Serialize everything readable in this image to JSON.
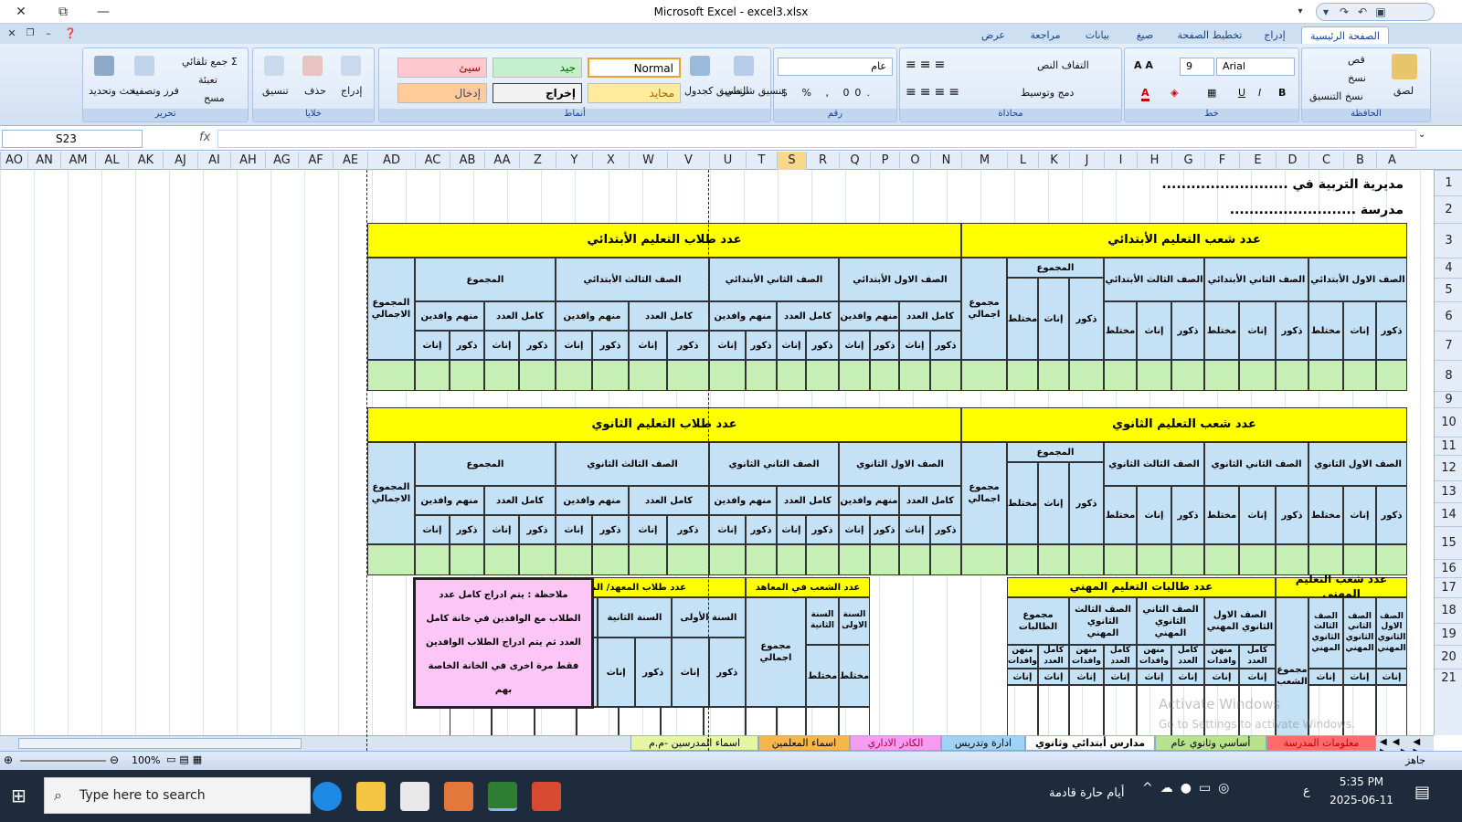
{
  "app": {
    "title": "Microsoft Excel - excel3.xlsx"
  },
  "window": {
    "close": "✕",
    "restore": "⧉",
    "minimize": "—"
  },
  "ribbon_tabs": [
    "الصفحة الرئيسية",
    "إدراج",
    "تخطيط الصفحة",
    "صيغ",
    "بيانات",
    "مراجعة",
    "عرض"
  ],
  "ribbon": {
    "clipboard": {
      "label": "الحافظة",
      "paste": "لصق",
      "cut": "قص",
      "copy": "نسخ",
      "format_painter": "نسخ التنسيق"
    },
    "font": {
      "label": "خط",
      "name": "Arial",
      "size": "9"
    },
    "alignment": {
      "label": "محاذاة",
      "wrap": "التفاف النص",
      "merge": "دمج وتوسيط"
    },
    "number": {
      "label": "رقم",
      "format": "عام"
    },
    "styles": {
      "label": "أنماط",
      "conditional": "تنسيق شرطي",
      "as_table": "التنسيق كجدول",
      "normal": "Normal",
      "good": "جيد",
      "bad": "سيئ",
      "neutral": "محايد",
      "output": "إخراج",
      "input": "إدخال"
    },
    "cells": {
      "label": "خلايا",
      "insert": "إدراج",
      "delete": "حذف",
      "format": "تنسيق"
    },
    "editing": {
      "label": "تحرير",
      "autosum": "جمع تلقائي",
      "fill": "تعبئة",
      "clear": "مسح",
      "sort": "فرز وتصفية",
      "find": "بحث وتحديد"
    }
  },
  "namebox": "S23",
  "fx": "fx",
  "columns": [
    "A",
    "B",
    "C",
    "D",
    "E",
    "F",
    "G",
    "H",
    "I",
    "J",
    "K",
    "L",
    "M",
    "N",
    "O",
    "P",
    "Q",
    "R",
    "S",
    "T",
    "U",
    "V",
    "W",
    "X",
    "Y",
    "Z",
    "AA",
    "AB",
    "AC",
    "AD",
    "AE",
    "AF",
    "AG",
    "AH",
    "AI",
    "AJ",
    "AK",
    "AL",
    "AM",
    "AN",
    "AO"
  ],
  "rows": [
    "1",
    "2",
    "3",
    "4",
    "5",
    "6",
    "7",
    "8",
    "9",
    "10",
    "11",
    "12",
    "13",
    "14",
    "15",
    "16",
    "17",
    "18",
    "19",
    "20",
    "21"
  ],
  "sheet": {
    "r1": "مديرية التربية في ..........................",
    "r2": "مدرسة ..........................",
    "prim_sections_title": "عدد شعب التعليم الأبتدائي",
    "prim_students_title": "عدد طلاب التعليم الأبتدائي",
    "sec_sections_title": "عدد شعب التعليم الثانوي",
    "sec_students_title": "عدد طلاب التعليم الثانوي",
    "p_g1": "الصف الاول الأبتدائي",
    "p_g2": "الصف الثاني الأبتدائي",
    "p_g3": "الصف الثالث الأبتدائي",
    "s_g1": "الصف الاول الثانوي",
    "s_g2": "الصف الثاني الثانوي",
    "s_g3": "الصف الثالث الثانوي",
    "total": "المجموع",
    "grand_total": "مجموع اجمالي",
    "overall_total": "المجموع الاجمالي",
    "males": "ذكور",
    "females": "إناث",
    "mixed": "مختلط",
    "full_count": "كامل العدد",
    "incl_arrivals": "منهم وافدين",
    "voc_sections_title": "عدد شعب التعليم المهني",
    "voc_students_title": "عدد طالبات التعليم المهني",
    "voc_g1": "الصف الاول الثانوي المهني",
    "voc_g2": "الصف الثاني الثانوي المهني",
    "voc_g3": "الصف الثالث الثانوي المهني",
    "voc_sec_total": "مجموع الشعب",
    "voc_students_total": "مجموع الطالبات",
    "voc_arrivals": "منهن وافدات",
    "inst_sections_title": "عدد الشعب في المعاهد",
    "inst_students_title": "عدد طلاب المعهد/ المصرفي - الصناعي/",
    "year1": "السنة الأولى",
    "year2": "السنة الثانية",
    "inst_year1": "السنة الاولى",
    "inst_year2": "السنة الثانية",
    "grand_total2": "مجموع اجمالي",
    "note": "ملاحظة : يتم ادراج كامل عدد الطلاب مع الوافدين في خانة كامل العدد ثم يتم ادراج الطلاب الوافدين فقط مرة اخرى في الخانة الخاصة بهم"
  },
  "sheet_tabs": [
    "معلومات المدرسة",
    "أساسي وثانوي عام",
    "مدارس أبتدائي وثانوي",
    "ادارة وتدريس",
    "الكادر الاداري",
    "اسماء المعلمين",
    "اسماء المدرسين -م.م"
  ],
  "status": {
    "ready": "جاهز",
    "zoom": "100%"
  },
  "watermark": {
    "line1": "Activate Windows",
    "line2": "Go to Settings to activate Windows."
  },
  "taskbar": {
    "search": "Type here to search",
    "weather": "أيام حارة قادمة",
    "time": "5:35 PM",
    "date": "2025-06-11",
    "lang": "ع"
  }
}
